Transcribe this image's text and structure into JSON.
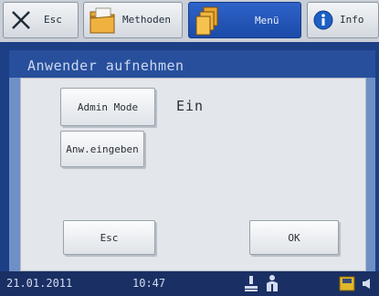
{
  "tabs": {
    "esc": {
      "label": "Esc",
      "icon": "close-x-icon"
    },
    "methoden": {
      "label": "Methoden",
      "icon": "folder-icon"
    },
    "menu": {
      "label": "Menü",
      "icon": "files-icon"
    },
    "info": {
      "label": "Info",
      "icon": "info-icon"
    }
  },
  "dialog": {
    "title": "Anwender aufnehmen",
    "admin_mode_label": "Admin Mode",
    "admin_mode_value": "Ein",
    "enter_user_label": "Anw.eingeben",
    "esc_label": "Esc",
    "ok_label": "OK"
  },
  "status": {
    "date": "21.01.2011",
    "time": "10:47",
    "icons": [
      "network-icon",
      "user-icon",
      "storage-icon",
      "speaker-icon"
    ]
  },
  "colors": {
    "active_tab": "#1b4aa8",
    "dialog_titlebar": "#274f9c",
    "status_bar": "#1a2f63"
  }
}
